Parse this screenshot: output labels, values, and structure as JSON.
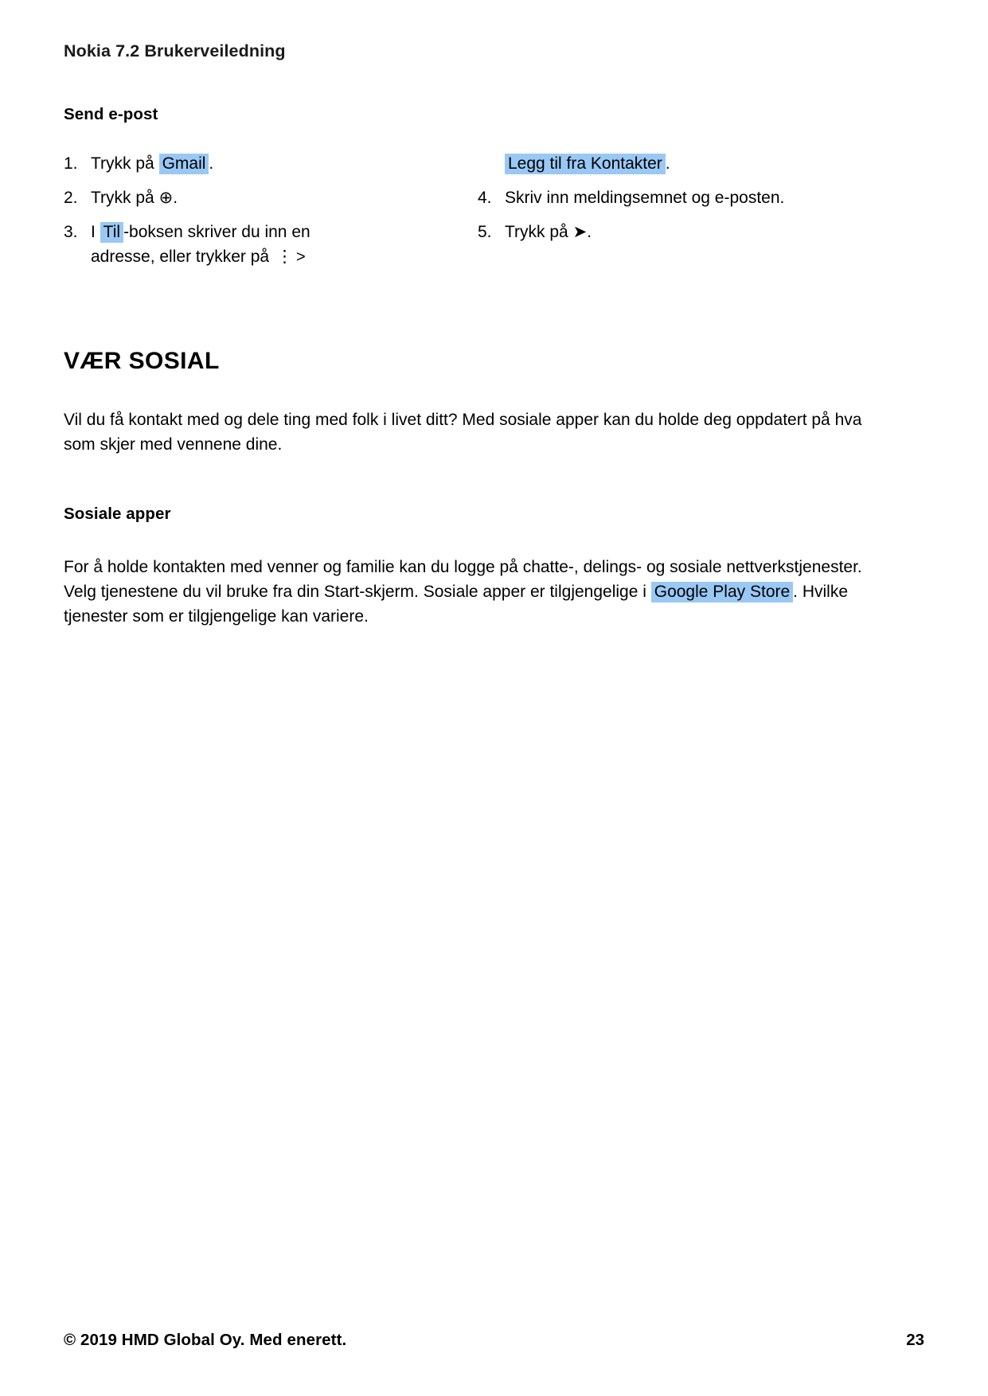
{
  "document": {
    "running_header": "Nokia 7.2 Brukerveiledning",
    "footer_copyright": "© 2019 HMD Global Oy. Med enerett.",
    "page_number": "23",
    "highlight_color": "#9ac8f5"
  },
  "send_email_section": {
    "heading": "Send e-post",
    "steps": [
      {
        "number": "1.",
        "text_before": "Trykk på ",
        "highlight": "Gmail",
        "text_after": "."
      },
      {
        "number": "2.",
        "text_before": "Trykk på ",
        "icon": "add-circle-icon",
        "icon_glyph": "⊕",
        "text_after": "."
      },
      {
        "number": "3.",
        "text_before": "I ",
        "highlight": "Til",
        "text_middle": "-boksen skriver du inn en",
        "line2_before": "adresse, eller trykker på ",
        "icon": "more-vertical-icon",
        "icon_glyph": "⋮",
        "icon2": "chevron-right-icon",
        "icon2_glyph": ">",
        "cont_highlight": "Legg til fra Kontakter",
        "cont_after": "."
      },
      {
        "number": "4.",
        "text_before": "Skriv inn meldingsemnet og e-posten."
      },
      {
        "number": "5.",
        "text_before": "Trykk på ",
        "icon": "send-icon",
        "icon_glyph": "➤",
        "text_after": "."
      }
    ]
  },
  "social_section": {
    "chapter_heading": "VÆR SOSIAL",
    "intro_paragraph": "Vil du få kontakt med og dele ting med folk i livet ditt? Med sosiale apper kan du holde deg oppdatert på hva som skjer med vennene dine.",
    "sub_heading": "Sosiale apper",
    "apps_paragraph_before": "For å holde kontakten med venner og familie kan du logge på chatte-, delings- og sosiale nettverkstjenester. Velg tjenestene du vil bruke fra din Start-skjerm. Sosiale apper er tilgjengelige i ",
    "apps_paragraph_highlight": "Google Play Store",
    "apps_paragraph_after": ". Hvilke tjenester som er tilgjengelige kan variere."
  }
}
